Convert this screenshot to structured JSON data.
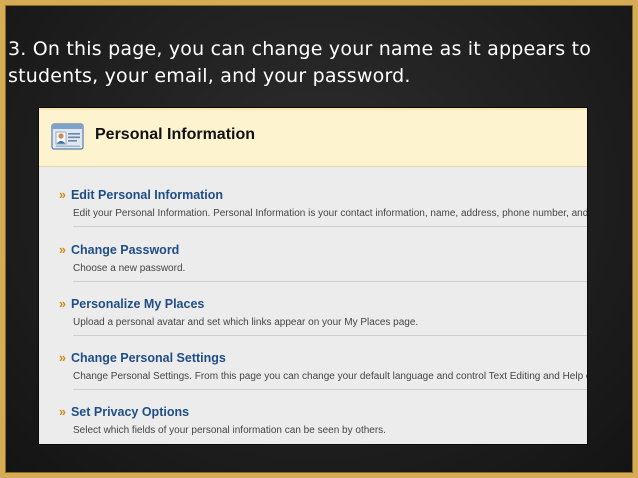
{
  "caption": "3. On this page, you can change your name as it appears to students, your email, and your password.",
  "panel": {
    "title": "Personal Information",
    "icon": "profile-card-icon"
  },
  "items": [
    {
      "label": "Edit Personal Information",
      "chevron": "»",
      "description": "Edit your Personal Information. Personal Information is your contact information, name, address, phone number, and s"
    },
    {
      "label": "Change Password",
      "chevron": "»",
      "description": "Choose a new password."
    },
    {
      "label": "Personalize My Places",
      "chevron": "»",
      "description": "Upload a personal avatar and set which links appear on your My Places page."
    },
    {
      "label": "Change Personal Settings",
      "chevron": "»",
      "description": "Change Personal Settings. From this page you can change your default language and control Text Editing and Help opt"
    },
    {
      "label": "Set Privacy Options",
      "chevron": "»",
      "description": "Select which fields of your personal information can be seen by others."
    }
  ],
  "colors": {
    "board": "#1c1c1c",
    "frame": "#d4ac54",
    "header_bg": "#fdf3cf",
    "link": "#1f4e86",
    "chevron": "#d08a1a"
  }
}
